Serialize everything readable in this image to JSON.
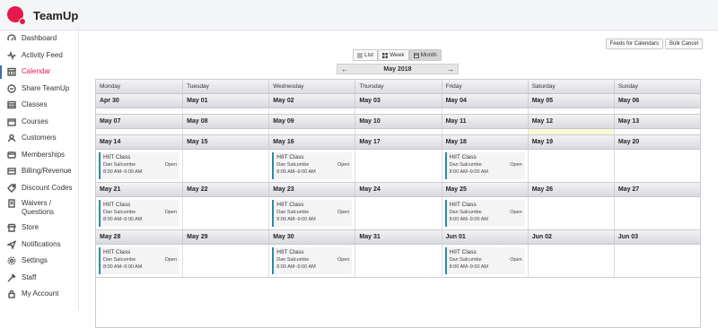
{
  "app": {
    "name": "TeamUp"
  },
  "sidebar": {
    "items": [
      {
        "label": "Dashboard",
        "icon": "dashboard-icon"
      },
      {
        "label": "Activity Feed",
        "icon": "activity-icon"
      },
      {
        "label": "Calendar",
        "icon": "calendar-icon",
        "active": true
      },
      {
        "label": "Share TeamUp",
        "icon": "share-icon"
      },
      {
        "label": "Classes",
        "icon": "classes-icon"
      },
      {
        "label": "Courses",
        "icon": "courses-icon"
      },
      {
        "label": "Customers",
        "icon": "customers-icon"
      },
      {
        "label": "Memberships",
        "icon": "memberships-icon"
      },
      {
        "label": "Billing/Revenue",
        "icon": "billing-icon"
      },
      {
        "label": "Discount Codes",
        "icon": "discount-icon"
      },
      {
        "label": "Waivers / Questions",
        "icon": "waivers-icon"
      },
      {
        "label": "Store",
        "icon": "store-icon"
      },
      {
        "label": "Notifications",
        "icon": "notifications-icon"
      },
      {
        "label": "Settings",
        "icon": "settings-icon"
      },
      {
        "label": "Staff",
        "icon": "staff-icon"
      },
      {
        "label": "My Account",
        "icon": "account-icon"
      }
    ]
  },
  "toolbar": {
    "feeds_label": "Feeds for Calendars",
    "bulk_cancel_label": "Bulk Cancel"
  },
  "views": {
    "list": "List",
    "week": "Week",
    "month": "Month",
    "active": "month"
  },
  "month_nav": {
    "prev": "←",
    "label": "May 2018",
    "next": "→"
  },
  "calendar": {
    "weekdays": [
      "Monday",
      "Tuesday",
      "Wednesday",
      "Thursday",
      "Friday",
      "Saturday",
      "Sunday"
    ],
    "weeks": [
      {
        "dates": [
          "Apr 30",
          "May 01",
          "May 02",
          "May 03",
          "May 04",
          "May 05",
          "May 06"
        ]
      },
      {
        "dates": [
          "May 07",
          "May 08",
          "May 09",
          "May 10",
          "May 11",
          "May 12",
          "May 13"
        ],
        "highlight": 5
      },
      {
        "dates": [
          "May 14",
          "May 15",
          "May 16",
          "May 17",
          "May 18",
          "May 19",
          "May 20"
        ]
      },
      {
        "dates": [
          "May 21",
          "May 22",
          "May 23",
          "May 24",
          "May 25",
          "May 26",
          "May 27"
        ]
      },
      {
        "dates": [
          "May 28",
          "May 29",
          "May 30",
          "May 31",
          "Jun 01",
          "Jun 02",
          "Jun 03"
        ]
      }
    ],
    "event": {
      "title": "HIIT Class",
      "instructor": "Dan Salcumbe",
      "status": "Open",
      "time": "8:00 AM–9:00 AM"
    }
  },
  "colors": {
    "brand": "#e6194b",
    "event_bar": "#2b8aa8",
    "highlight": "#fafbd6"
  }
}
